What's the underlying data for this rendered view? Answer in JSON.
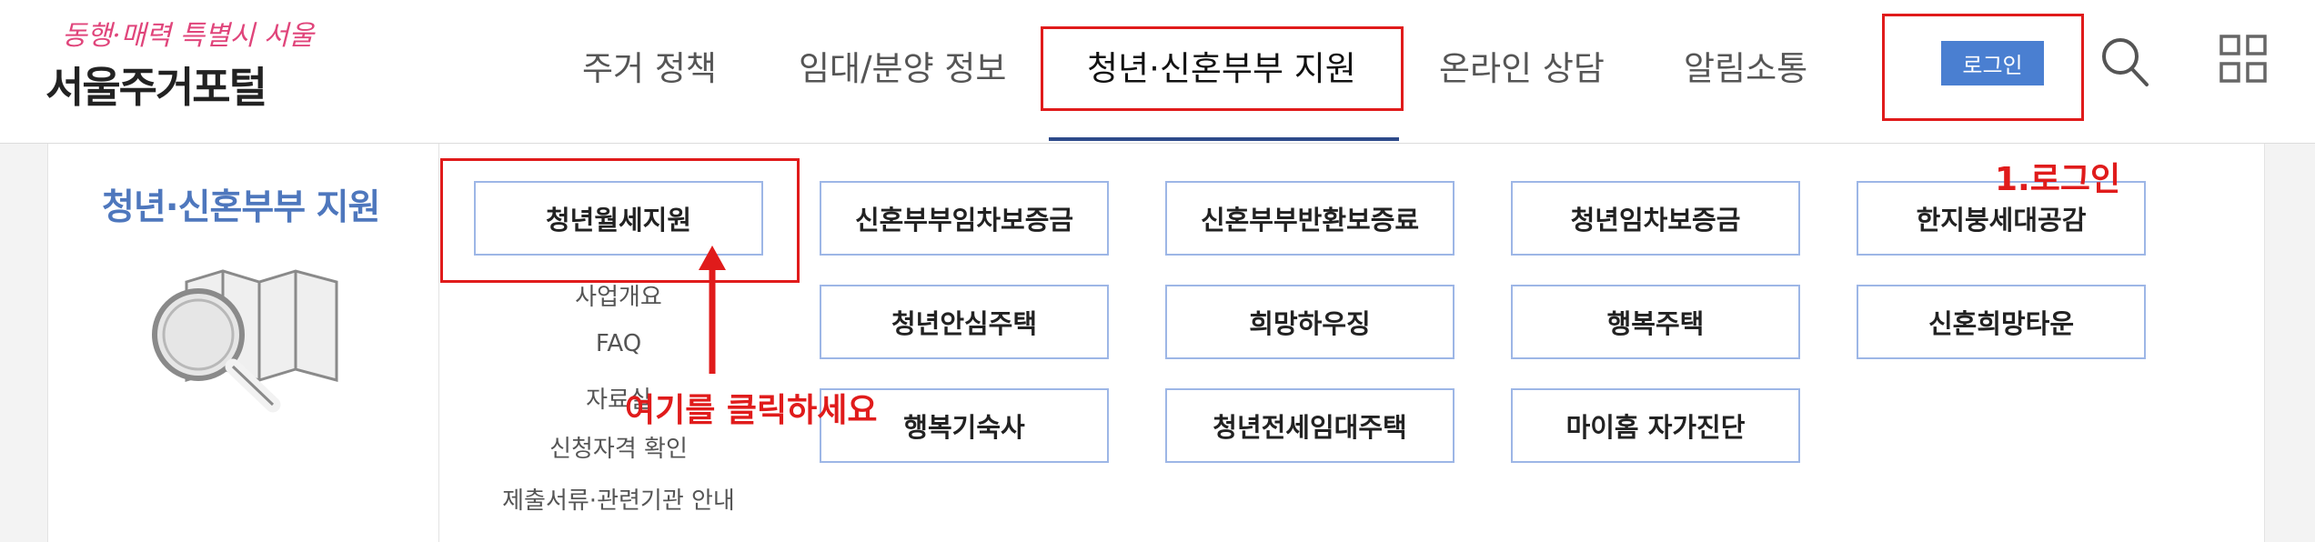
{
  "logo": {
    "slogan": "동행·매력 특별시 서울",
    "title": "서울주거포털"
  },
  "nav": {
    "items": [
      {
        "label": "주거 정책"
      },
      {
        "label": "임대/분양 정보"
      },
      {
        "label": "청년·신혼부부 지원"
      },
      {
        "label": "온라인 상담"
      },
      {
        "label": "알림소통"
      }
    ],
    "active_index": 2
  },
  "header_actions": {
    "login_label": "로그인",
    "icons": [
      "search-icon",
      "grid-menu-icon"
    ]
  },
  "mega_menu": {
    "section_title": "청년·신혼부부 지원",
    "section_icon": "map-magnifier-icon",
    "cards": [
      {
        "label": "청년월세지원"
      },
      {
        "label": "신혼부부임차보증금"
      },
      {
        "label": "신혼부부반환보증료"
      },
      {
        "label": "청년임차보증금"
      },
      {
        "label": "한지붕세대공감"
      },
      {
        "label": "청년안심주택"
      },
      {
        "label": "희망하우징"
      },
      {
        "label": "행복주택"
      },
      {
        "label": "신혼희망타운"
      },
      {
        "label": "행복기숙사"
      },
      {
        "label": "청년전세임대주택"
      },
      {
        "label": "마이홈 자가진단"
      }
    ],
    "sub_items": [
      {
        "label": "사업개요"
      },
      {
        "label": "FAQ"
      },
      {
        "label": "자료실"
      },
      {
        "label": "신청자격 확인"
      },
      {
        "label": "제출서류·관련기관 안내"
      }
    ]
  },
  "annotations": {
    "login_hint": "1.로그인",
    "click_hint": "여기를 클릭하세요"
  },
  "colors": {
    "accent_blue": "#4e77bd",
    "login_button": "#4a7fd1",
    "card_border": "#9db6e6",
    "annotation_red": "#e01b1b",
    "nav_underline": "#2d4a8a"
  }
}
